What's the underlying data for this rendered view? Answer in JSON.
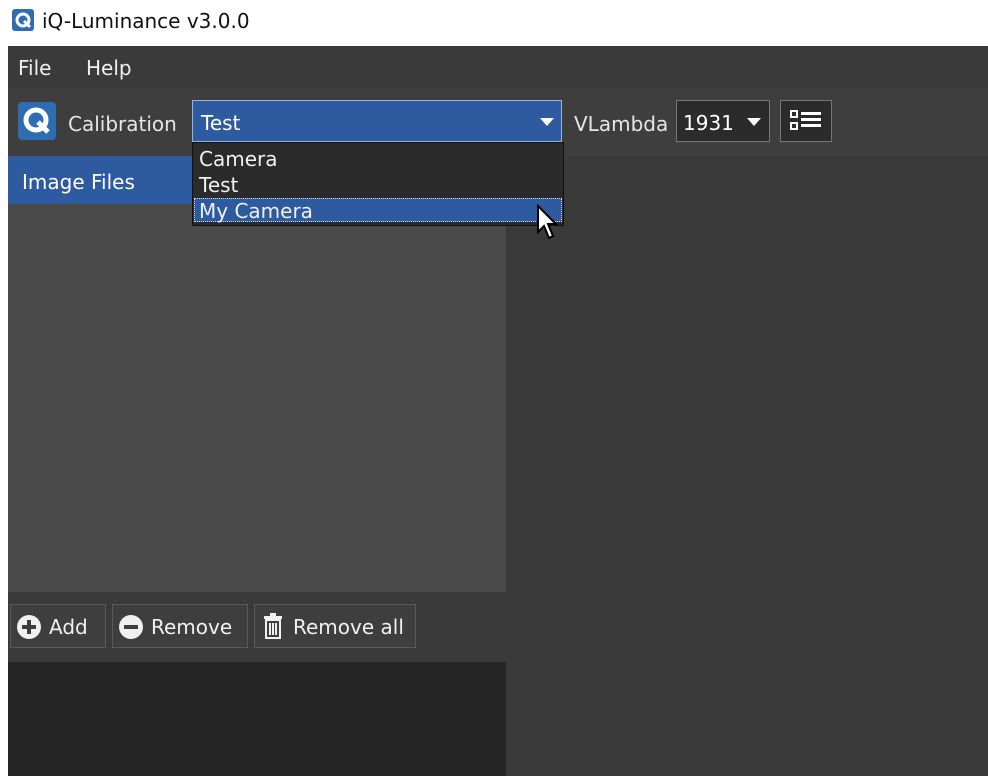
{
  "titlebar": {
    "title": "iQ-Luminance v3.0.0"
  },
  "menubar": {
    "items": [
      "File",
      "Help"
    ]
  },
  "toolbar": {
    "calibration_label": "Calibration",
    "calibration_value": "Test",
    "vlambda_label": "VLambda",
    "vlambda_value": "1931"
  },
  "dropdown": {
    "options": [
      "Camera",
      "Test",
      "My Camera"
    ],
    "highlighted": "My Camera"
  },
  "left_panel": {
    "header": "Image Files"
  },
  "buttons": {
    "add": "Add",
    "remove": "Remove",
    "remove_all": "Remove all"
  },
  "colors": {
    "accent": "#2e5aa0",
    "panel": "#4a4a4a",
    "dark": "#262626",
    "app_icon": "#2f6db3"
  },
  "icons": {
    "app": "iq-logo-icon",
    "add": "plus-circle-icon",
    "remove": "minus-circle-icon",
    "remove_all": "trash-icon",
    "list": "list-icon"
  }
}
